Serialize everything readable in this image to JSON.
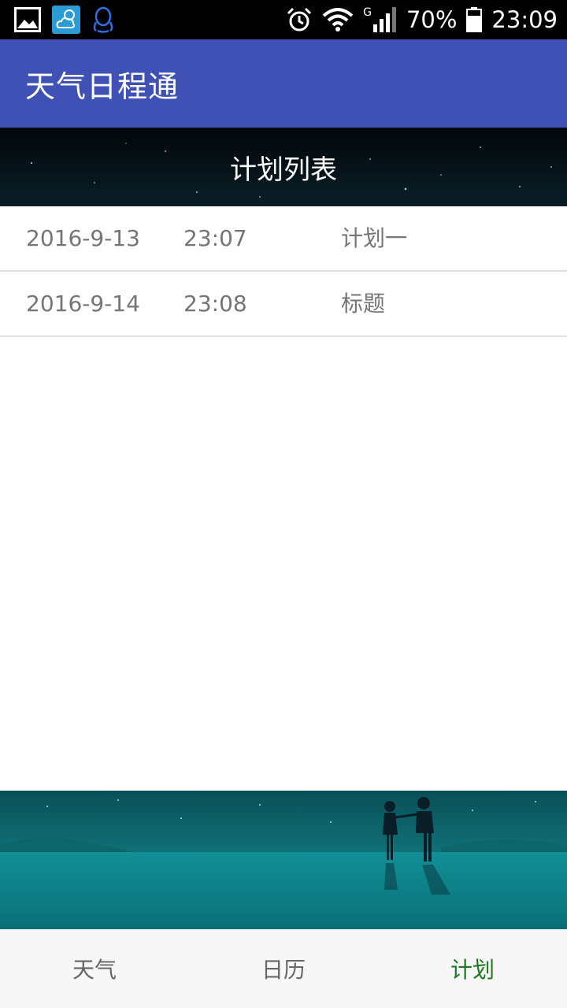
{
  "status_bar": {
    "signal_label": "G",
    "battery": "70%",
    "time": "23:09",
    "icons": [
      "gallery-icon",
      "weather-app-icon",
      "qq-icon",
      "alarm-icon",
      "wifi-icon",
      "cell-signal-icon",
      "battery-icon"
    ]
  },
  "app_bar": {
    "title": "天气日程通"
  },
  "banner": {
    "title": "计划列表"
  },
  "plans": [
    {
      "date": "2016-9-13",
      "time": "23:07",
      "title": "计划一"
    },
    {
      "date": "2016-9-14",
      "time": "23:08",
      "title": "标题"
    }
  ],
  "tabs": [
    {
      "label": "天气",
      "active": false
    },
    {
      "label": "日历",
      "active": false
    },
    {
      "label": "计划",
      "active": true
    }
  ],
  "colors": {
    "status_bar": "#000000",
    "app_bar": "#3f51b5",
    "row_text": "#757575",
    "tab_active": "#1b7a1b",
    "tab_inactive": "#666666",
    "tab_bar_bg": "#f7f7f7"
  }
}
